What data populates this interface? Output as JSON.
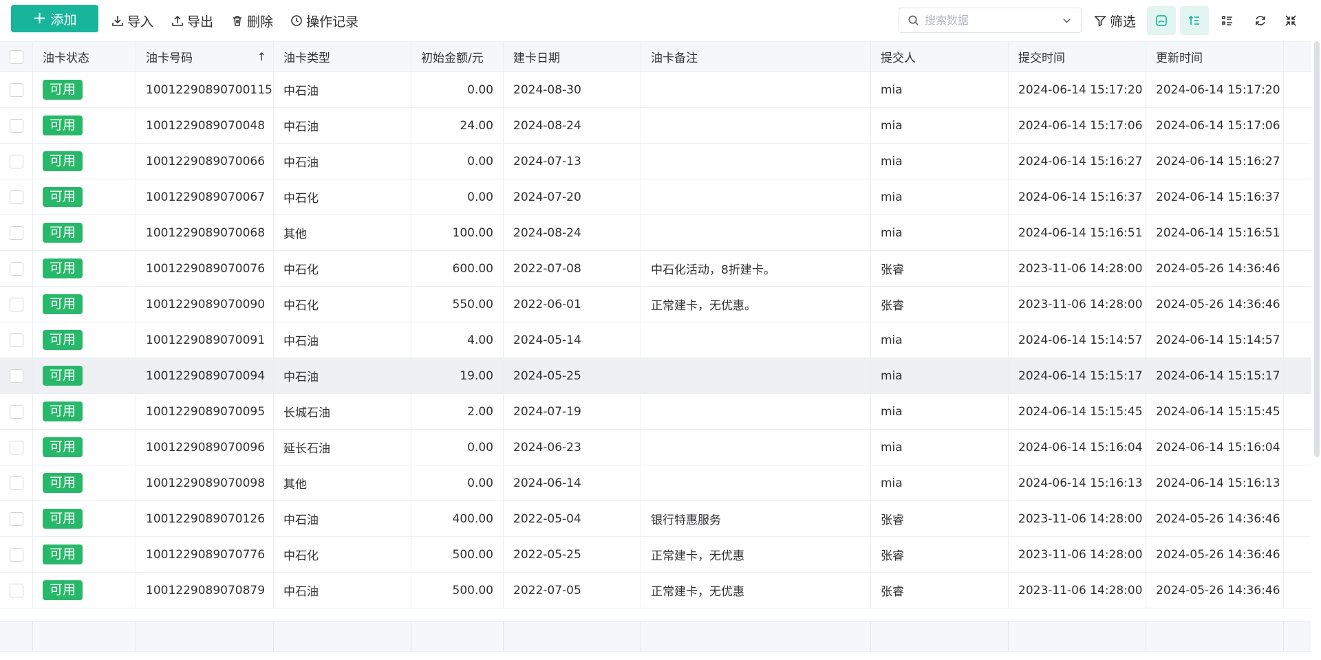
{
  "toolbar": {
    "add_label": "添加",
    "import_label": "导入",
    "export_label": "导出",
    "delete_label": "删除",
    "log_label": "操作记录",
    "search_placeholder": "搜索数据",
    "filter_label": "筛选",
    "accent_color": "#17b69b"
  },
  "table": {
    "columns": [
      "油卡状态",
      "油卡号码",
      "油卡类型",
      "初始金额/元",
      "建卡日期",
      "油卡备注",
      "提交人",
      "提交时间",
      "更新时间"
    ],
    "sort_indicator": "↑",
    "status_color": "#28b86a",
    "rows": [
      {
        "status": "可用",
        "number": "10012290890700115",
        "type": "中石油",
        "amount": "0.00",
        "date": "2024-08-30",
        "note": "",
        "submitter": "mia",
        "submit_time": "2024-06-14 15:17:20",
        "update_time": "2024-06-14 15:17:20"
      },
      {
        "status": "可用",
        "number": "1001229089070048",
        "type": "中石油",
        "amount": "24.00",
        "date": "2024-08-24",
        "note": "",
        "submitter": "mia",
        "submit_time": "2024-06-14 15:17:06",
        "update_time": "2024-06-14 15:17:06"
      },
      {
        "status": "可用",
        "number": "1001229089070066",
        "type": "中石油",
        "amount": "0.00",
        "date": "2024-07-13",
        "note": "",
        "submitter": "mia",
        "submit_time": "2024-06-14 15:16:27",
        "update_time": "2024-06-14 15:16:27"
      },
      {
        "status": "可用",
        "number": "1001229089070067",
        "type": "中石化",
        "amount": "0.00",
        "date": "2024-07-20",
        "note": "",
        "submitter": "mia",
        "submit_time": "2024-06-14 15:16:37",
        "update_time": "2024-06-14 15:16:37"
      },
      {
        "status": "可用",
        "number": "1001229089070068",
        "type": "其他",
        "amount": "100.00",
        "date": "2024-08-24",
        "note": "",
        "submitter": "mia",
        "submit_time": "2024-06-14 15:16:51",
        "update_time": "2024-06-14 15:16:51"
      },
      {
        "status": "可用",
        "number": "1001229089070076",
        "type": "中石化",
        "amount": "600.00",
        "date": "2022-07-08",
        "note": "中石化活动，8折建卡。",
        "submitter": "张睿",
        "submit_time": "2023-11-06 14:28:00",
        "update_time": "2024-05-26 14:36:46"
      },
      {
        "status": "可用",
        "number": "1001229089070090",
        "type": "中石化",
        "amount": "550.00",
        "date": "2022-06-01",
        "note": "正常建卡，无优惠。",
        "submitter": "张睿",
        "submit_time": "2023-11-06 14:28:00",
        "update_time": "2024-05-26 14:36:46"
      },
      {
        "status": "可用",
        "number": "1001229089070091",
        "type": "中石油",
        "amount": "4.00",
        "date": "2024-05-14",
        "note": "",
        "submitter": "mia",
        "submit_time": "2024-06-14 15:14:57",
        "update_time": "2024-06-14 15:14:57"
      },
      {
        "status": "可用",
        "number": "1001229089070094",
        "type": "中石油",
        "amount": "19.00",
        "date": "2024-05-25",
        "note": "",
        "submitter": "mia",
        "submit_time": "2024-06-14 15:15:17",
        "update_time": "2024-06-14 15:15:17"
      },
      {
        "status": "可用",
        "number": "1001229089070095",
        "type": "长城石油",
        "amount": "2.00",
        "date": "2024-07-19",
        "note": "",
        "submitter": "mia",
        "submit_time": "2024-06-14 15:15:45",
        "update_time": "2024-06-14 15:15:45"
      },
      {
        "status": "可用",
        "number": "1001229089070096",
        "type": "延长石油",
        "amount": "0.00",
        "date": "2024-06-23",
        "note": "",
        "submitter": "mia",
        "submit_time": "2024-06-14 15:16:04",
        "update_time": "2024-06-14 15:16:04"
      },
      {
        "status": "可用",
        "number": "1001229089070098",
        "type": "其他",
        "amount": "0.00",
        "date": "2024-06-14",
        "note": "",
        "submitter": "mia",
        "submit_time": "2024-06-14 15:16:13",
        "update_time": "2024-06-14 15:16:13"
      },
      {
        "status": "可用",
        "number": "1001229089070126",
        "type": "中石油",
        "amount": "400.00",
        "date": "2022-05-04",
        "note": "银行特惠服务",
        "submitter": "张睿",
        "submit_time": "2023-11-06 14:28:00",
        "update_time": "2024-05-26 14:36:46"
      },
      {
        "status": "可用",
        "number": "1001229089070776",
        "type": "中石化",
        "amount": "500.00",
        "date": "2022-05-25",
        "note": "正常建卡，无优惠",
        "submitter": "张睿",
        "submit_time": "2023-11-06 14:28:00",
        "update_time": "2024-05-26 14:36:46"
      },
      {
        "status": "可用",
        "number": "1001229089070879",
        "type": "中石油",
        "amount": "500.00",
        "date": "2022-07-05",
        "note": "正常建卡，无优惠",
        "submitter": "张睿",
        "submit_time": "2023-11-06 14:28:00",
        "update_time": "2024-05-26 14:36:46"
      }
    ]
  }
}
